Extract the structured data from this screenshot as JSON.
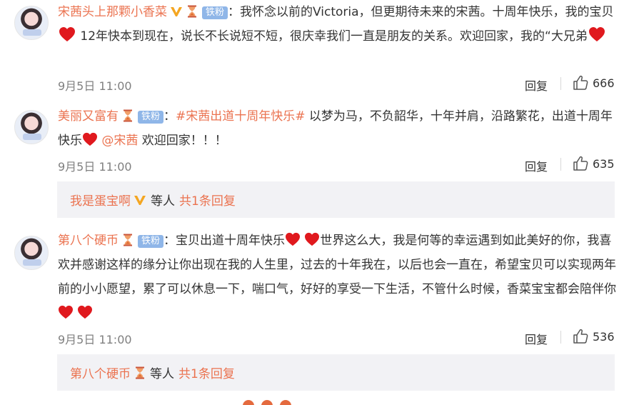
{
  "comments": [
    {
      "username": "宋茜头上那颗小香菜",
      "fan_badge": "铁粉",
      "text_a": "：我怀念以前的Victoria，但更期待未来的宋茜。十周年快乐，我的宝贝",
      "text_b": " 12年快本到现在，说长不长说短不短，很庆幸我们一直是朋友的关系。欢迎回家，我的“大兄弟",
      "time": "9月5日 11:00",
      "reply_label": "回复",
      "likes": "666"
    },
    {
      "username": "美丽又富有",
      "fan_badge": "铁粉",
      "colon": "：",
      "topic": "#宋茜出道十周年快乐#",
      "text_a": " 以梦为马，不负韶华，十年并肩，沿路繁花，出道十周年快乐",
      "mention": "@宋茜",
      "text_b": " 欢迎回家！！！",
      "time": "9月5日 11:00",
      "reply_label": "回复",
      "likes": "635",
      "sub_reply": {
        "user": "我是蛋宝啊",
        "others": "等人",
        "count_text": "共1条回复"
      }
    },
    {
      "username": "第八个硬币",
      "fan_badge": "铁粉",
      "text_a": "：宝贝出道十周年快乐",
      "text_b": "世界这么大，我是何等的幸运遇到如此美好的你，我喜欢并感谢这样的缘分让你出现在我的人生里，过去的十年我在，以后也会一直在，希望宝贝可以实现两年前的小小愿望，累了可以休息一下，喘口气，好好的享受一下生活，不管什么时候，香菜宝宝都会陪伴你",
      "time": "9月5日 11:00",
      "reply_label": "回复",
      "likes": "536",
      "sub_reply": {
        "user": "第八个硬币",
        "others": "等人",
        "count_text": "共1条回复"
      }
    }
  ],
  "colors": {
    "accent": "#eb7350",
    "fan_badge": "#8fb6e8",
    "reply_bg": "#f2f2f5",
    "heart": "#e0191e"
  },
  "icons": [
    "avatar",
    "verified-v-icon",
    "hourglass-icon",
    "heart-icon",
    "thumbs-up-icon"
  ]
}
